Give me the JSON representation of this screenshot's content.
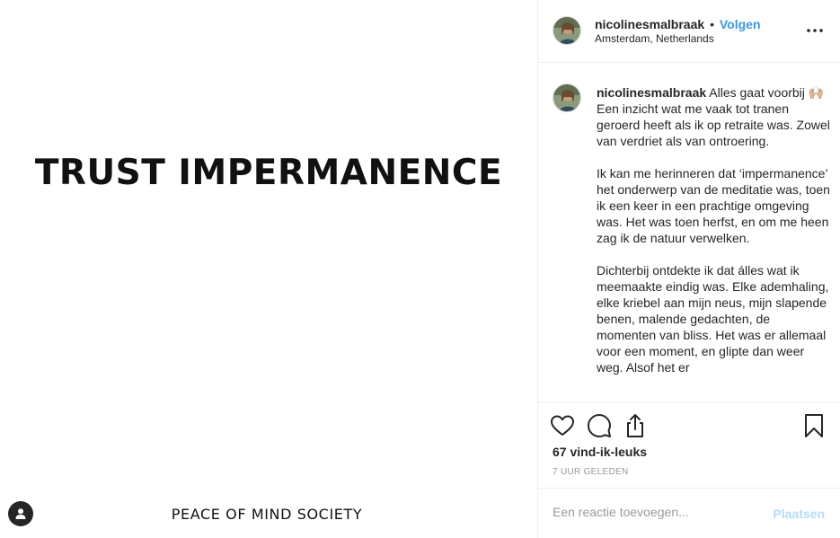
{
  "post": {
    "image_title": "TRUST IMPERMANENCE",
    "image_footer": "PEACE OF MIND SOCIETY"
  },
  "header": {
    "username": "nicolinesmalbraak",
    "separator": "•",
    "follow_label": "Volgen",
    "location": "Amsterdam, Netherlands"
  },
  "caption": {
    "username": "nicolinesmalbraak",
    "text": " Alles gaat voorbij 🙌🏼\nEen inzicht wat me vaak tot tranen geroerd heeft als ik op retraite was. Zowel van verdriet als van ontroering.\n\nIk kan me herinneren dat ‘impermanence’ het onderwerp van de meditatie was, toen ik een keer in een prachtige omgeving was. Het was toen herfst, en om me heen zag ik de natuur verwelken.\n\nDichterbij ontdekte ik dat álles wat ik meemaakte eindig was. Elke ademhaling, elke kriebel aan mijn neus, mijn slapende benen, malende gedachten, de momenten van bliss. Het was er allemaal voor een moment, en glipte dan weer weg. Alsof het er"
  },
  "stats": {
    "likes": "67 vind-ik-leuks",
    "time": "7 UUR GELEDEN"
  },
  "comment": {
    "placeholder": "Een reactie toevoegen...",
    "post_label": "Plaatsen"
  },
  "colors": {
    "link": "#3897f0",
    "post_disabled": "#b3dbff"
  },
  "icons": [
    "more-options-icon",
    "heart-icon",
    "comment-icon",
    "share-icon",
    "bookmark-icon",
    "user-tag-icon"
  ]
}
